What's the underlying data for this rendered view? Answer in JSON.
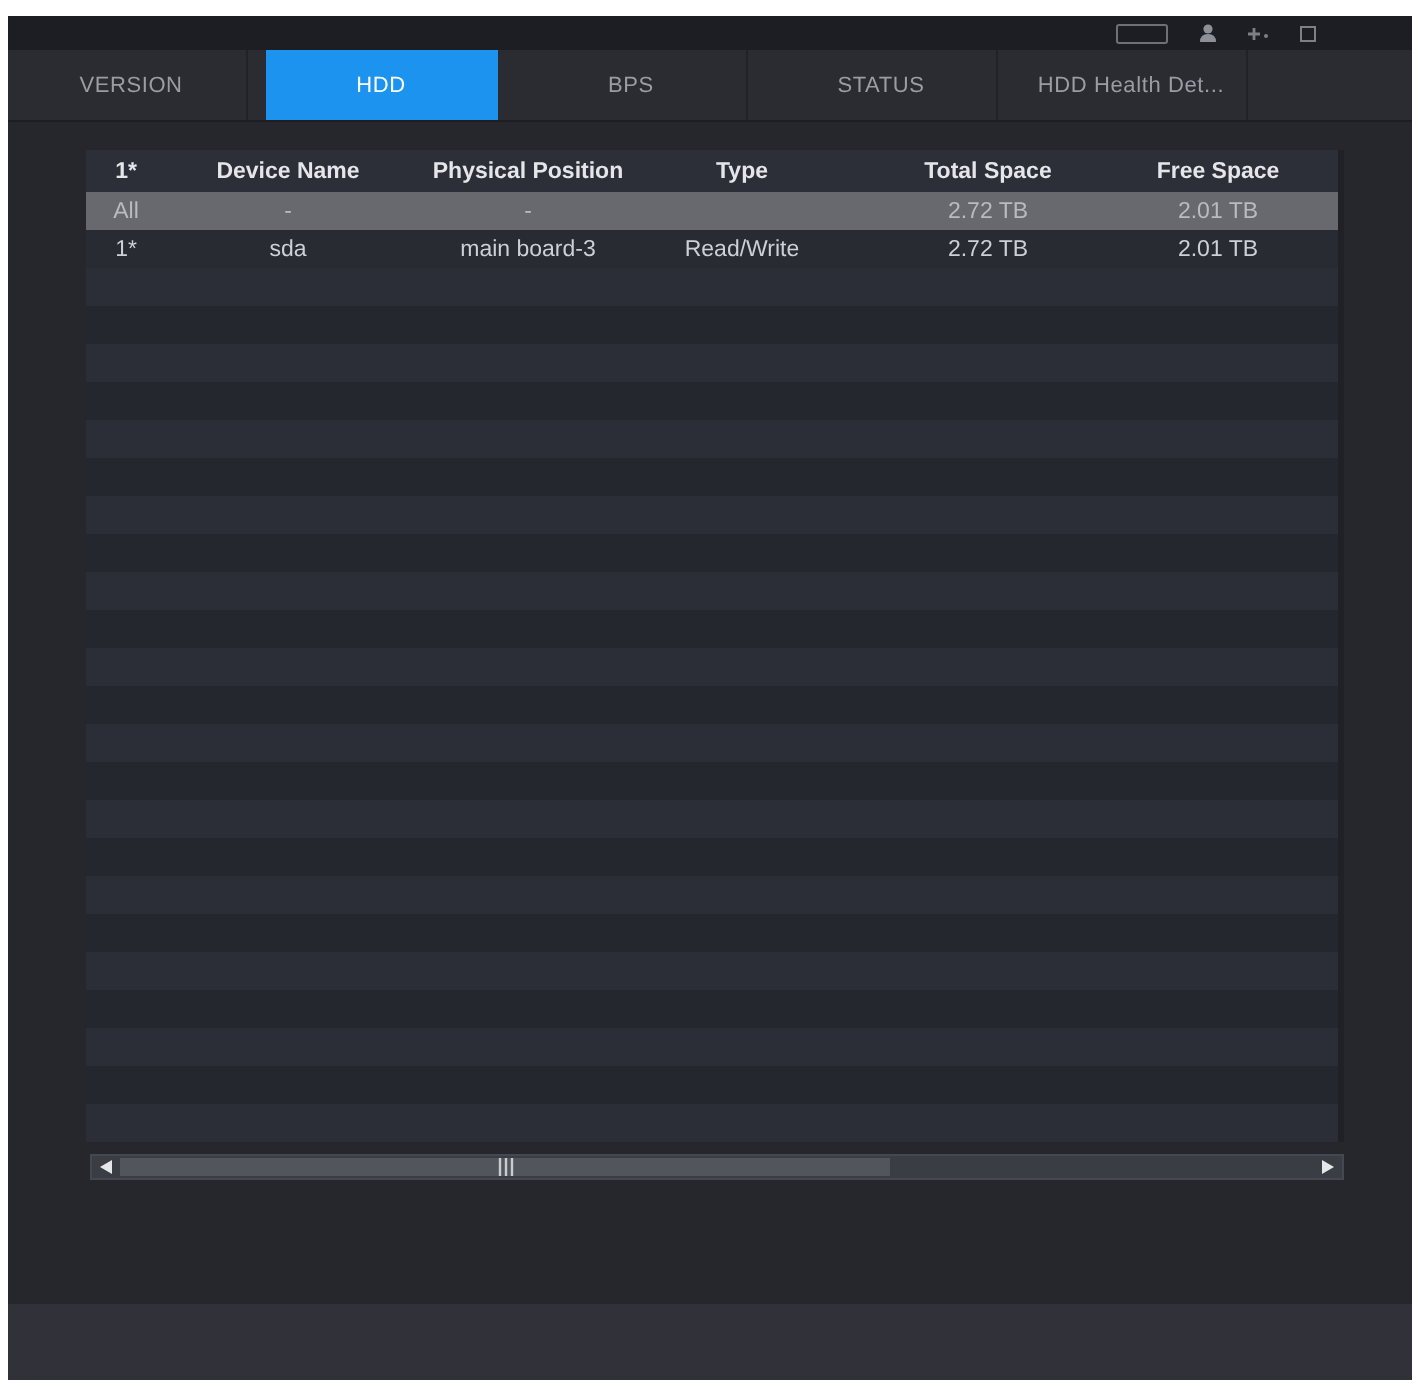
{
  "tabs": [
    {
      "label": "VERSION",
      "selected": false
    },
    {
      "label": "HDD",
      "selected": true
    },
    {
      "label": "BPS",
      "selected": false
    },
    {
      "label": "STATUS",
      "selected": false
    },
    {
      "label": "HDD Health Det...",
      "selected": false
    }
  ],
  "table": {
    "columns": [
      {
        "label": "1*"
      },
      {
        "label": "Device Name"
      },
      {
        "label": "Physical Position"
      },
      {
        "label": "Type"
      },
      {
        "label": "Total Space"
      },
      {
        "label": "Free Space"
      }
    ],
    "rows": [
      {
        "selected": true,
        "index": "All",
        "device_name": "-",
        "physical_position": "-",
        "total_space": "2.72 TB",
        "free_space": "2.01 TB"
      },
      {
        "selected": false,
        "index": "1*",
        "device_name": "sda",
        "physical_position": "main board-3",
        "type": "Read/Write",
        "total_space": "2.72 TB",
        "free_space": "2.01 TB"
      }
    ]
  }
}
